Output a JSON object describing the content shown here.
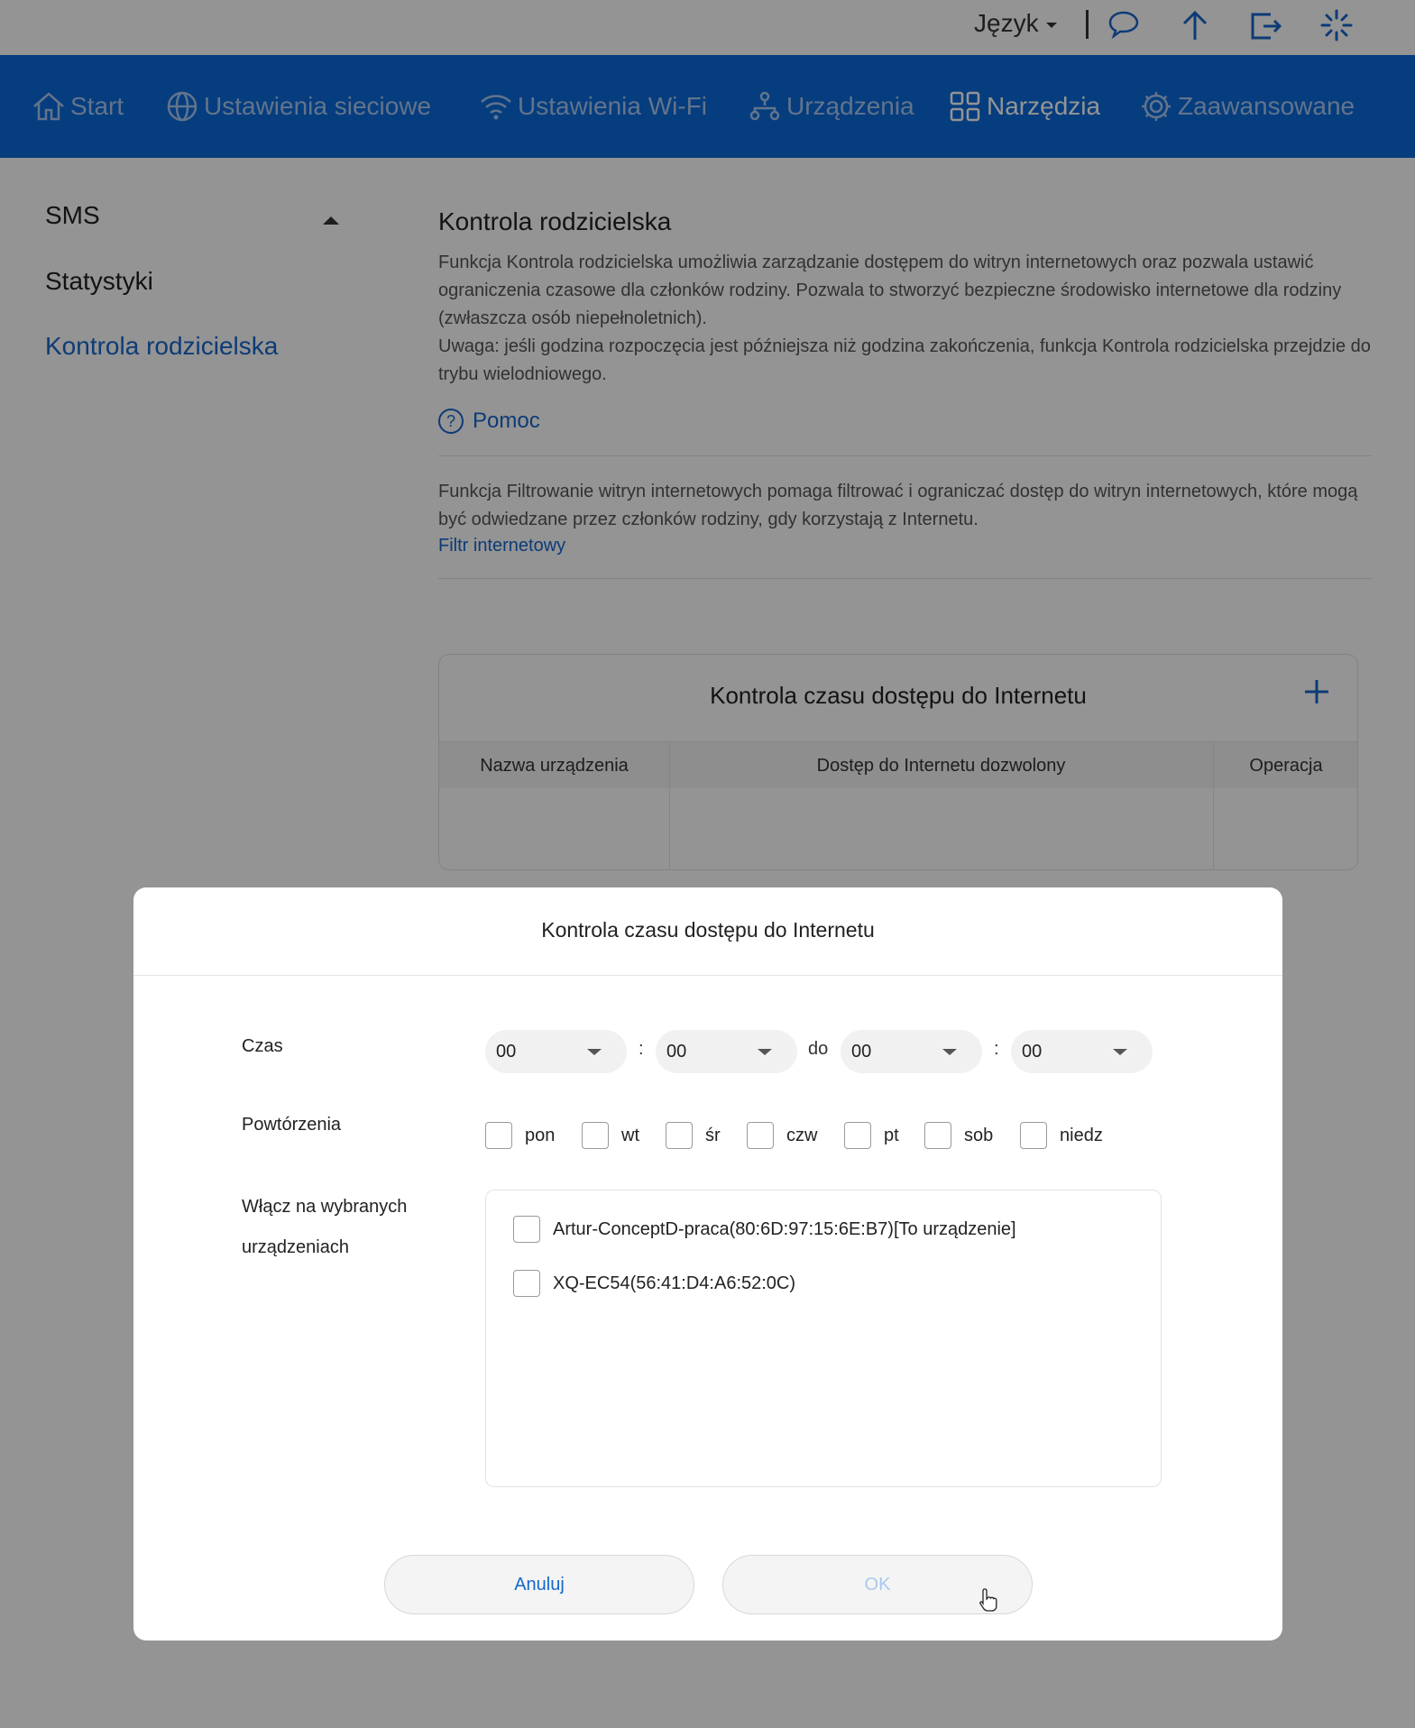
{
  "topbar": {
    "language_label": "Język",
    "icons": [
      "chat-icon",
      "upload-icon",
      "logout-icon",
      "loading-icon"
    ]
  },
  "nav": {
    "items": [
      {
        "label": "Start",
        "icon": "home-icon",
        "active": false
      },
      {
        "label": "Ustawienia sieciowe",
        "icon": "globe-icon",
        "active": false
      },
      {
        "label": "Ustawienia Wi-Fi",
        "icon": "wifi-icon",
        "active": false
      },
      {
        "label": "Urządzenia",
        "icon": "devices-icon",
        "active": false
      },
      {
        "label": "Narzędzia",
        "icon": "tools-icon",
        "active": true
      },
      {
        "label": "Zaawansowane",
        "icon": "gear-icon",
        "active": false
      }
    ]
  },
  "sidebar": {
    "items": [
      {
        "label": "SMS"
      },
      {
        "label": "Statystyki"
      },
      {
        "label": "Kontrola rodzicielska",
        "active": true
      }
    ]
  },
  "main": {
    "title": "Kontrola rodzicielska",
    "description_1": "Funkcja Kontrola rodzicielska umożliwia zarządzanie dostępem do witryn internetowych oraz pozwala ustawić ograniczenia czasowe dla członków rodziny. Pozwala to stworzyć bezpieczne środowisko internetowe dla rodziny (zwłaszcza osób niepełnoletnich).",
    "description_2": "Uwaga: jeśli godzina rozpoczęcia jest późniejsza niż godzina zakończenia, funkcja Kontrola rodzicielska przejdzie do trybu wielodniowego.",
    "help_label": "Pomoc",
    "filter_description": "Funkcja Filtrowanie witryn internetowych pomaga filtrować i ograniczać dostęp do witryn internetowych, które mogą być odwiedzane przez członków rodziny, gdy korzystają z Internetu.",
    "filter_link": "Filtr internetowy",
    "table": {
      "title": "Kontrola czasu dostępu do Internetu",
      "columns": [
        "Nazwa urządzenia",
        "Dostęp do Internetu dozwolony",
        "Operacja"
      ]
    }
  },
  "modal": {
    "title": "Kontrola czasu dostępu do Internetu",
    "time_label": "Czas",
    "time": {
      "start_hour": "00",
      "start_minute": "00",
      "to_word": "do",
      "end_hour": "00",
      "end_minute": "00",
      "colon": ":"
    },
    "repeat_label": "Powtórzenia",
    "days": [
      "pon",
      "wt",
      "śr",
      "czw",
      "pt",
      "sob",
      "niedz"
    ],
    "devices_label_1": "Włącz na wybranych",
    "devices_label_2": "urządzeniach",
    "devices": [
      "Artur-ConceptD-praca(80:6D:97:15:6E:B7)[To urządzenie]",
      "XQ-EC54(56:41:D4:A6:52:0C)"
    ],
    "cancel_label": "Anuluj",
    "ok_label": "OK"
  },
  "colors": {
    "accent": "#0b6ad9",
    "link": "#1767cc",
    "ok_disabled": "#a9c9ef"
  }
}
